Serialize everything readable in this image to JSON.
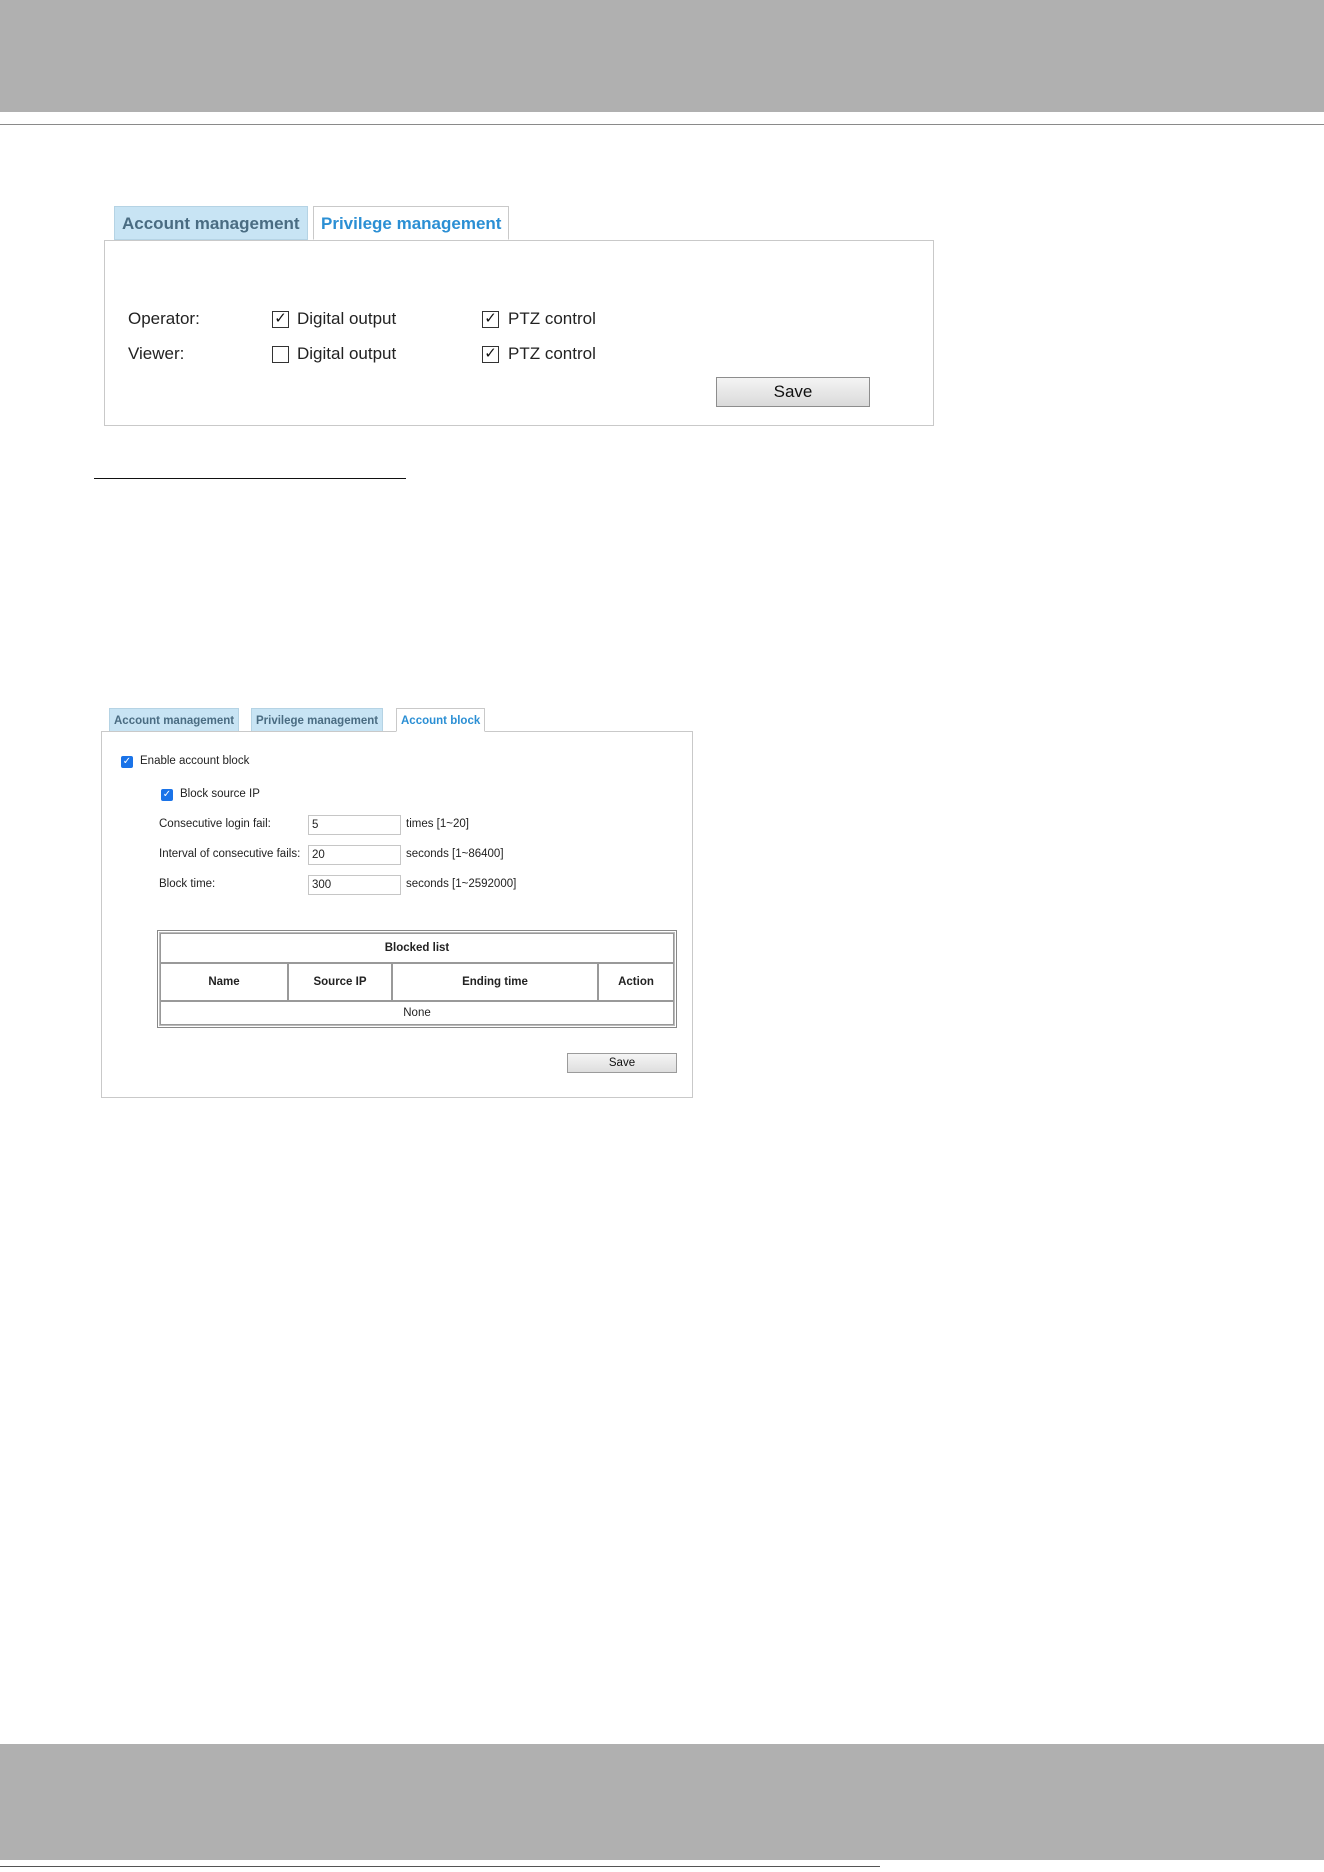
{
  "colors": {
    "band_gray": "#b0b0b0",
    "inactive_tab_bg": "#c8e4f4",
    "inactive_tab_text": "#4a6c82",
    "active_tab_text": "#2b8fd4",
    "checkbox_checked": "#1a73e8"
  },
  "privilege_panel": {
    "tabs": [
      {
        "label": "Account management",
        "active": false
      },
      {
        "label": "Privilege management",
        "active": true
      }
    ],
    "rows": [
      {
        "role": "Operator:",
        "digital_output": {
          "label": "Digital output",
          "checked": true
        },
        "ptz_control": {
          "label": "PTZ control",
          "checked": true
        }
      },
      {
        "role": "Viewer:",
        "digital_output": {
          "label": "Digital output",
          "checked": false
        },
        "ptz_control": {
          "label": "PTZ control",
          "checked": true
        }
      }
    ],
    "save_label": "Save"
  },
  "account_block_panel": {
    "tabs": [
      {
        "label": "Account management",
        "active": false
      },
      {
        "label": "Privilege management",
        "active": false
      },
      {
        "label": "Account block",
        "active": true
      }
    ],
    "enable_account_block": {
      "label": "Enable account block",
      "checked": true
    },
    "block_source_ip": {
      "label": "Block source IP",
      "checked": true
    },
    "fields": [
      {
        "label": "Consecutive login fail:",
        "value": "5",
        "unit": "times [1~20]"
      },
      {
        "label": "Interval of consecutive fails:",
        "value": "20",
        "unit": "seconds [1~86400]"
      },
      {
        "label": "Block time:",
        "value": "300",
        "unit": "seconds [1~2592000]"
      }
    ],
    "blocked_list": {
      "title": "Blocked list",
      "columns": [
        "Name",
        "Source IP",
        "Ending time",
        "Action"
      ],
      "empty_text": "None"
    },
    "save_label": "Save"
  }
}
